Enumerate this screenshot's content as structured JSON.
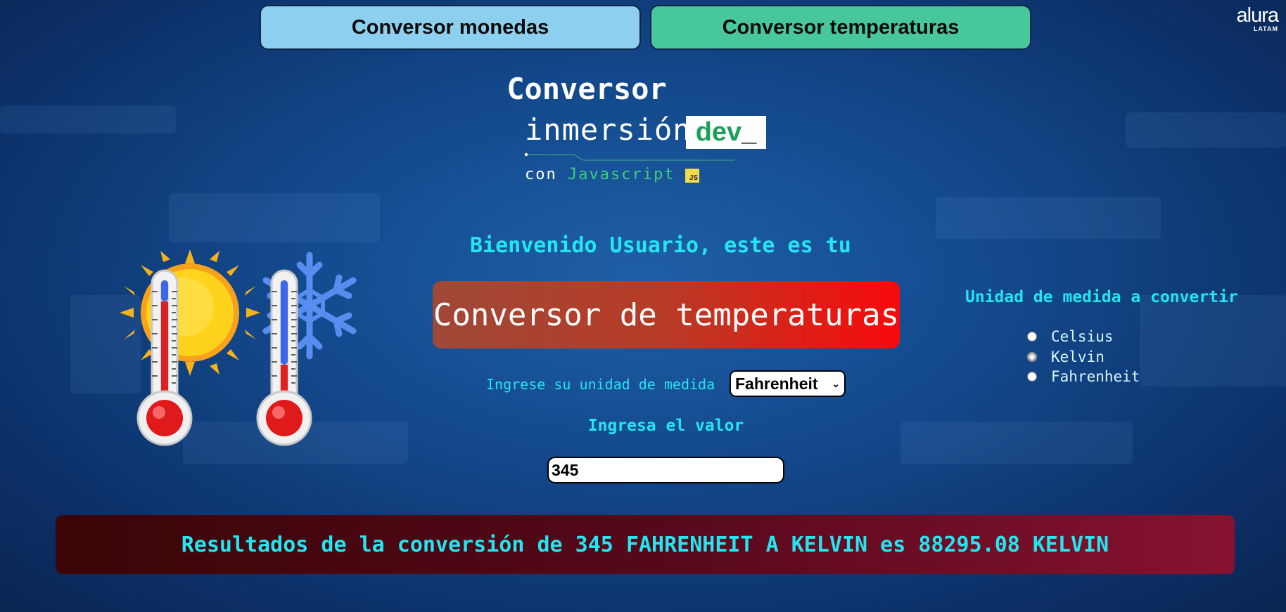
{
  "nav": {
    "monedas_label": "Conversor monedas",
    "temperaturas_label": "Conversor temperaturas"
  },
  "brand": {
    "alura": "alura",
    "latam": "LATAM"
  },
  "header": {
    "title": "Conversor",
    "inmersion": "inmersión",
    "dev": "dev",
    "con": "con",
    "javascript": "Javascript",
    "js_badge": "JS"
  },
  "main": {
    "welcome": "Bienvenido Usuario, este es tu",
    "title": "Conversor de temperaturas",
    "unit_label": "Ingrese su unidad de medida",
    "unit_selected": "Fahrenheit",
    "value_label": "Ingresa el valor",
    "value": "345"
  },
  "target": {
    "title": "Unidad de medida a convertir",
    "options": [
      "Celsius",
      "Kelvin",
      "Fahrenheit"
    ],
    "selected": "Kelvin"
  },
  "result": {
    "text": "Resultados de la conversión de 345 FAHRENHEIT A KELVIN es 88295.08 KELVIN"
  },
  "icons": {
    "hot": "thermometer-sun-icon",
    "cold": "thermometer-snowflake-icon"
  },
  "colors": {
    "accent_text": "#22e6f0",
    "nav_monedas": "#8ccfee",
    "nav_temperaturas": "#48c79c",
    "title_bg_end": "#f80a0a"
  }
}
